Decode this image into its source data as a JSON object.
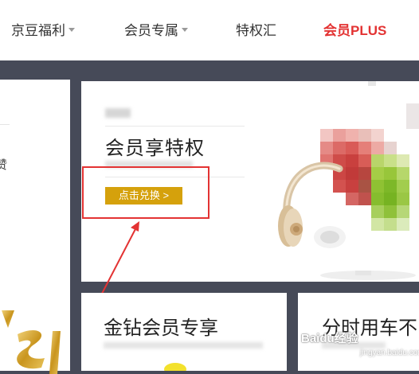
{
  "nav": {
    "items": [
      {
        "label": "京豆福利",
        "dropdown": true
      },
      {
        "label": "会员专属",
        "dropdown": true
      },
      {
        "label": "特权汇",
        "dropdown": false
      },
      {
        "label": "会员PLUS",
        "dropdown": false
      }
    ],
    "plus_color": "#e33333"
  },
  "left_card": {
    "partial_char": "赞"
  },
  "promo": {
    "title": "会员享特权",
    "button_label": "点击兑换 >",
    "button_color": "#d5a10c",
    "highlight_color": "#e33333"
  },
  "cards": [
    {
      "title": "金钻会员专享"
    },
    {
      "title": "分时用车不"
    }
  ],
  "watermark": {
    "text": "Baidu经验",
    "sub": "jingyan.baidu.com"
  },
  "colors": {
    "page_bg": "#464a58",
    "card_bg": "#ffffff"
  }
}
